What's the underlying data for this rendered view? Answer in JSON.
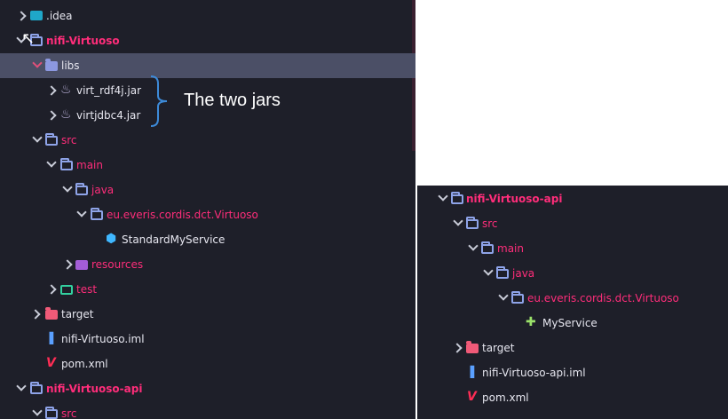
{
  "left_tree": [
    {
      "label": "idea_label",
      "text": ".idea"
    },
    {
      "text": "nifi-Virtuoso"
    },
    {
      "text": "libs"
    },
    {
      "text": "virt_rdf4j.jar"
    },
    {
      "text": "virtjdbc4.jar"
    },
    {
      "text": "src"
    },
    {
      "text": "main"
    },
    {
      "text": "java"
    },
    {
      "text": "eu.everis.cordis.dct.Virtuoso"
    },
    {
      "text": "StandardMyService"
    },
    {
      "text": "resources"
    },
    {
      "text": "test"
    },
    {
      "text": "target"
    },
    {
      "text": "nifi-Virtuoso.iml"
    },
    {
      "text": "pom.xml"
    },
    {
      "text": "nifi-Virtuoso-api"
    },
    {
      "text": "src"
    }
  ],
  "right_tree": [
    {
      "text": "nifi-Virtuoso-api"
    },
    {
      "text": "src"
    },
    {
      "text": "main"
    },
    {
      "text": "java"
    },
    {
      "text": "eu.everis.cordis.dct.Virtuoso"
    },
    {
      "text": "MyService"
    },
    {
      "text": "target"
    },
    {
      "text": "nifi-Virtuoso-api.iml"
    },
    {
      "text": "pom.xml"
    }
  ],
  "annotation": {
    "text": "The two jars"
  },
  "colors": {
    "panel_bg": "#1e1f29",
    "selected_row": "#4b4f66",
    "module_text": "#ff2d7a",
    "folder_blue": "#8ea3e8"
  }
}
